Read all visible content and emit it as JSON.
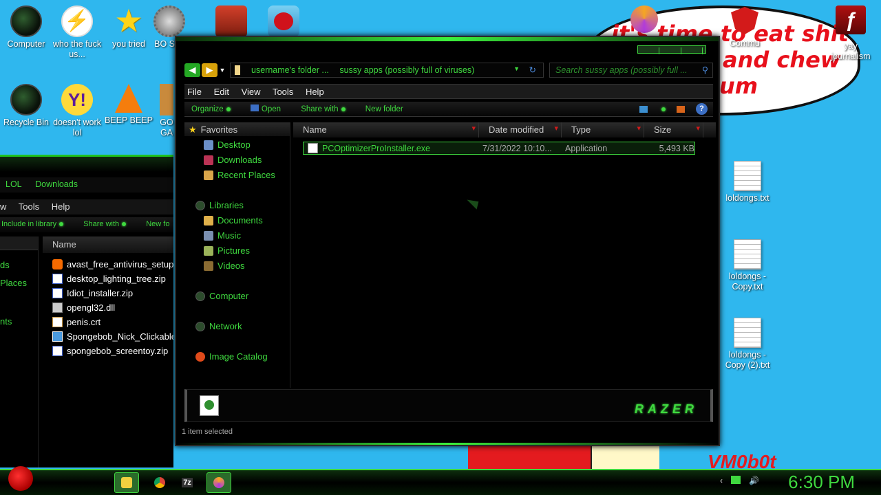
{
  "wallpaper": {
    "line1": "it's time to eat shit",
    "line2": "and chew",
    "line3": "um",
    "bottom_text": "VM0b0t"
  },
  "desktop_icons": [
    {
      "label": "Computer",
      "icon": "computer-orb-icon"
    },
    {
      "label": "who the fuck us...",
      "icon": "avast-bolt-icon"
    },
    {
      "label": "you tried",
      "icon": "star-icon"
    },
    {
      "label": "BO SIM",
      "icon": "gear-ball-icon"
    },
    {
      "label": "",
      "icon": "angry-birds-seasons-icon"
    },
    {
      "label": "",
      "icon": "angry-birds-icon"
    },
    {
      "label": "Recycle Bin",
      "icon": "recycle-bin-icon"
    },
    {
      "label": "doesn't work lol",
      "icon": "yahoo-messenger-icon"
    },
    {
      "label": "BEEP BEEP",
      "icon": "vlc-cone-icon"
    },
    {
      "label": "GO GA",
      "icon": "box-icon"
    },
    {
      "label": "Commu",
      "icon": "shield-icon"
    },
    {
      "label": "yay journalism",
      "icon": "flash-icon"
    },
    {
      "label": "loldongs.txt",
      "icon": "text-file-icon"
    },
    {
      "label": "loldongs - Copy.txt",
      "icon": "text-file-icon"
    },
    {
      "label": "loldongs - Copy (2).txt",
      "icon": "text-file-icon"
    }
  ],
  "bg_window": {
    "address": [
      "LOL",
      "Downloads"
    ],
    "menu": [
      "w",
      "Tools",
      "Help"
    ],
    "commands": [
      "Include in library",
      "Share with",
      "New fo"
    ],
    "nav_items": [
      "ds",
      "Places",
      "nts"
    ],
    "column_name": "Name",
    "files": [
      {
        "name": "avast_free_antivirus_setup_",
        "icon": "avast"
      },
      {
        "name": "desktop_lighting_tree.zip",
        "icon": "zip"
      },
      {
        "name": "Idiot_installer.zip",
        "icon": "zip"
      },
      {
        "name": "opengl32.dll",
        "icon": "dll"
      },
      {
        "name": "penis.crt",
        "icon": "crt"
      },
      {
        "name": "Spongebob_Nick_Clickable",
        "icon": "exe"
      },
      {
        "name": "spongebob_screentoy.zip",
        "icon": "zip"
      }
    ]
  },
  "main_window": {
    "breadcrumbs": [
      "username's folder ...",
      "sussy apps (possibly full of viruses)"
    ],
    "search_placeholder": "Search sussy apps (possibly full ...",
    "menu": [
      "File",
      "Edit",
      "View",
      "Tools",
      "Help"
    ],
    "commands": [
      "Organize",
      "Open",
      "Share with",
      "New folder"
    ],
    "favorites_header": "Favorites",
    "favorites": [
      "Desktop",
      "Downloads",
      "Recent Places"
    ],
    "libraries_header": "Libraries",
    "libraries": [
      "Documents",
      "Music",
      "Pictures",
      "Videos"
    ],
    "computer": "Computer",
    "network": "Network",
    "image_catalog": "Image Catalog",
    "columns": [
      "Name",
      "Date modified",
      "Type",
      "Size"
    ],
    "file": {
      "name": "PCOptimizerProInstaller.exe",
      "date": "7/31/2022 10:10...",
      "type": "Application",
      "size": "5,493 KB"
    },
    "brand": "RAZER",
    "status": "1 item selected"
  },
  "taskbar": {
    "clock": "6:30 PM",
    "apps": [
      "Windows Explorer",
      "Chrome",
      "7-Zip",
      "Firefox"
    ],
    "seven_zip_label": "7z"
  },
  "colors": {
    "accent": "#3fd93f",
    "sky": "#2fb7ee",
    "window": "#000000"
  }
}
